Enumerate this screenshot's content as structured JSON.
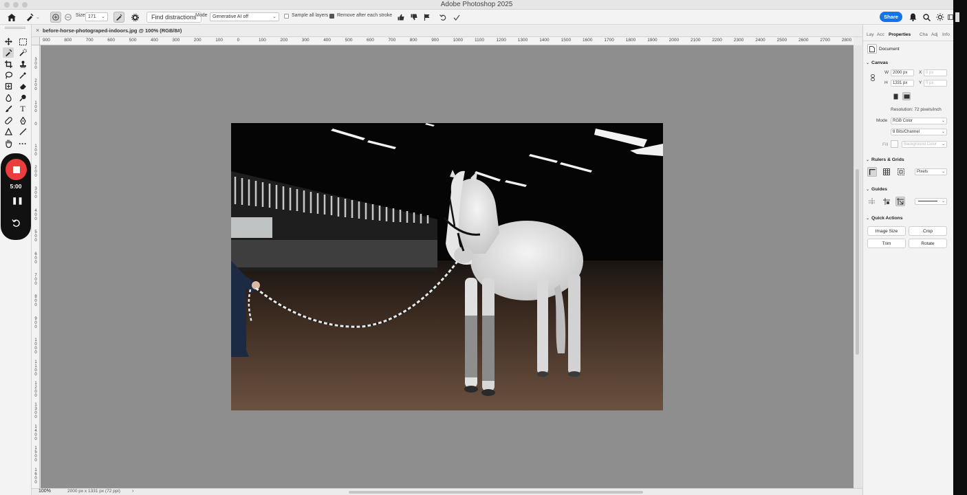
{
  "window": {
    "title": "Adobe Photoshop 2025"
  },
  "options_bar": {
    "size_label": "Size",
    "size_value": "171",
    "find_distractions": "Find distractions",
    "mode_label": "Mode",
    "mode_value": "Generative AI off",
    "sample_all_layers": "Sample all layers",
    "sample_all_layers_checked": false,
    "remove_after_stroke": "Remove after each stroke",
    "remove_after_stroke_checked": true,
    "share": "Share",
    "accent_color": "#1473e6"
  },
  "document": {
    "tab_title": "before-horse-photograped-indoors.jpg @ 100% (RGB/8#)",
    "close_glyph": "×"
  },
  "ruler": {
    "horizontal": [
      "900",
      "800",
      "700",
      "600",
      "500",
      "400",
      "300",
      "200",
      "100",
      "0",
      "100",
      "200",
      "300",
      "400",
      "500",
      "600",
      "700",
      "800",
      "900",
      "1000",
      "1100",
      "1200",
      "1300",
      "1400",
      "1500",
      "1600",
      "1700",
      "1800",
      "1900",
      "2000",
      "2100",
      "2200",
      "2300",
      "2400",
      "2500",
      "2600",
      "2700",
      "2800"
    ],
    "vertical": [
      "300",
      "200",
      "100",
      "0",
      "100",
      "200",
      "300",
      "400",
      "500",
      "600",
      "700",
      "800",
      "900",
      "1000",
      "1100",
      "1200",
      "1300",
      "1400",
      "1500",
      "1600"
    ]
  },
  "recorder": {
    "time": "5:00"
  },
  "status": {
    "zoom": "100%",
    "info": "2000 px x 1331 px (72 ppi)",
    "arrow": "›"
  },
  "properties": {
    "tabs": [
      "Lay",
      "Acc",
      "Properties",
      "Cha",
      "Adj",
      "Info"
    ],
    "active_tab": "Properties",
    "document_label": "Document",
    "canvas": {
      "title": "Canvas",
      "w_label": "W",
      "w_value": "2000 px",
      "h_label": "H",
      "h_value": "1331 px",
      "x_label": "X",
      "x_value": "0 px",
      "y_label": "Y",
      "y_value": "0 px",
      "resolution": "Resolution: 72 pixels/inch",
      "mode_label": "Mode",
      "mode_value": "RGB Color",
      "bits_value": "8 Bits/Channel",
      "fill_label": "Fill",
      "fill_value": "Background Color"
    },
    "rulers_grids": {
      "title": "Rulers & Grids",
      "units": "Pixels"
    },
    "guides": {
      "title": "Guides"
    },
    "quick_actions": {
      "title": "Quick Actions",
      "buttons": [
        "Image Size",
        "Crop",
        "Trim",
        "Rotate"
      ]
    }
  }
}
